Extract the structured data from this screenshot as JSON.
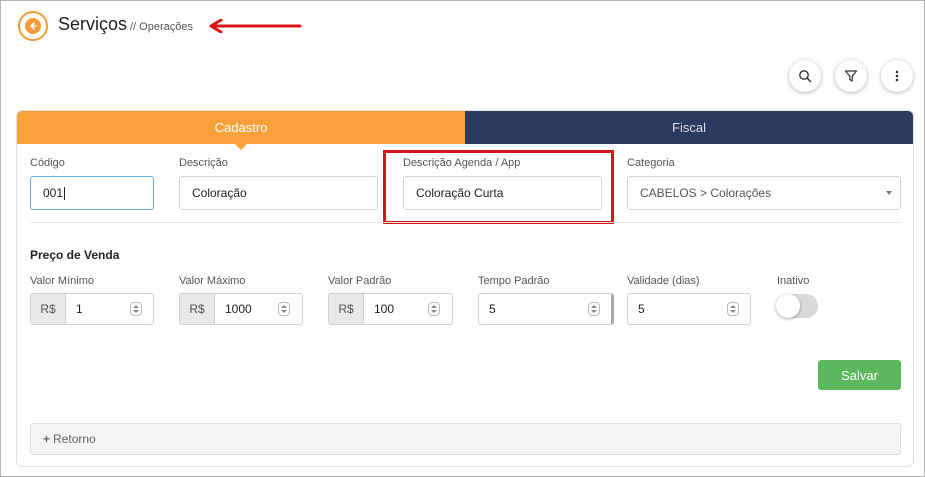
{
  "header": {
    "title": "Serviços",
    "subtitle": "// Operações",
    "accent_color": "#f39a35",
    "annotation_color": "#d9141b"
  },
  "toolbar": {
    "search_icon": "search-icon",
    "filter_icon": "filter-icon",
    "more_icon": "more-vertical-icon"
  },
  "tabs": [
    {
      "label": "Cadastro",
      "active": true,
      "color": "#f8a03a"
    },
    {
      "label": "Fiscal",
      "active": false,
      "color": "#2b3a60"
    }
  ],
  "form": {
    "codigo": {
      "label": "Código",
      "value": "001"
    },
    "descricao": {
      "label": "Descrição",
      "value": "Coloração"
    },
    "descricao_agenda": {
      "label": "Descrição Agenda / App",
      "value": "Coloração Curta"
    },
    "categoria": {
      "label": "Categoria",
      "value": "CABELOS > Colorações"
    }
  },
  "preco": {
    "section_title": "Preço de Venda",
    "currency": "R$",
    "valor_minimo": {
      "label": "Valor Mínimo",
      "value": "1"
    },
    "valor_maximo": {
      "label": "Valor Máximo",
      "value": "1000"
    },
    "valor_padrao": {
      "label": "Valor Padrão",
      "value": "100"
    },
    "tempo_padrao": {
      "label": "Tempo Padrão",
      "value": "5"
    },
    "validade": {
      "label": "Validade (dias)",
      "value": "5"
    },
    "inativo": {
      "label": "Inativo",
      "checked": false
    }
  },
  "actions": {
    "save_label": "Salvar",
    "save_color": "#5cb85c",
    "retorno_label": "Retorno"
  }
}
